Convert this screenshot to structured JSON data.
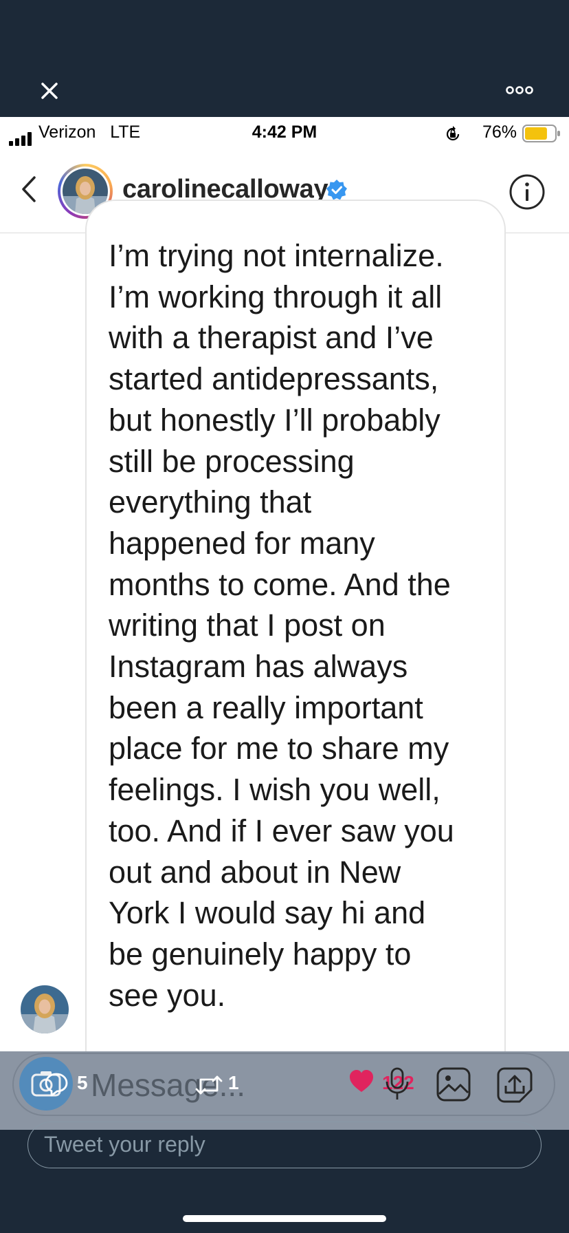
{
  "twitter_bar": {
    "close_icon": "close-icon",
    "more_icon": "more-dots-icon"
  },
  "status_bar": {
    "carrier": "Verizon",
    "network": "LTE",
    "time": "4:42 PM",
    "battery_percent": "76%",
    "battery_level": 0.76
  },
  "header": {
    "username": "carolinecalloway",
    "verified": true,
    "accent_color": "#3897f0"
  },
  "message": {
    "lines": [
      "I’m trying not internalize.",
      "I’m working through it all",
      "with a therapist and I’ve",
      "started antidepressants,",
      "but honestly I’ll probably",
      "still be processing",
      "everything that",
      "happened for many",
      "months to come. And the",
      "writing that I post on",
      "Instagram has always",
      "been a really important",
      "place for me to share my",
      "feelings. I wish you well,",
      "too. And if I ever saw you",
      "out and about in New",
      "York I would say hi and",
      "be genuinely happy to",
      "see you."
    ]
  },
  "composer": {
    "placeholder": "Message..."
  },
  "tweet_actions": {
    "replies": "5",
    "retweets": "1",
    "likes": "122",
    "like_color": "#e0245e"
  },
  "tweet_reply": {
    "placeholder": "Tweet your reply"
  }
}
